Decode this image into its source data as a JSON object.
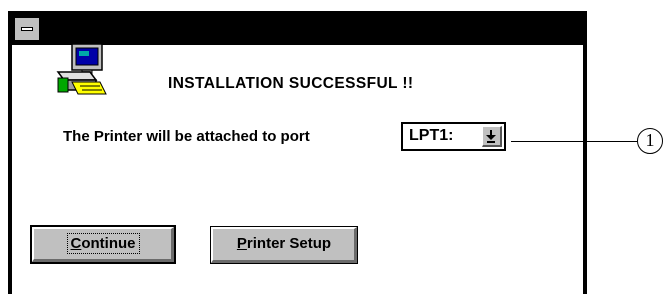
{
  "dialog": {
    "message": "INSTALLATION SUCCESSFUL !!",
    "port_label": "The Printer will be attached to port",
    "port_value": "LPT1:",
    "continue_mnemonic": "C",
    "continue_rest": "ontinue",
    "setup_mnemonic": "P",
    "setup_rest": "rinter Setup"
  },
  "annotation": {
    "callout": "1"
  },
  "icons": {
    "system_menu": "system-menu-icon",
    "app": "computer-printer-icon",
    "dropdown": "dropdown-arrow-icon"
  },
  "colors": {
    "titlebar": "#000000",
    "button_face": "#c0c0c0",
    "background": "#ffffff"
  }
}
